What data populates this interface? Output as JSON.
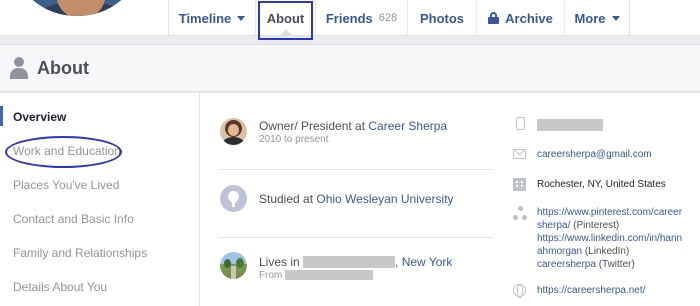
{
  "nav": {
    "tabs": {
      "timeline": "Timeline",
      "about": "About",
      "friends": "Friends",
      "friends_count": "628",
      "photos": "Photos",
      "archive": "Archive",
      "more": "More"
    }
  },
  "section": {
    "title": "About"
  },
  "sidebar": {
    "items": [
      {
        "label": "Overview",
        "active": true
      },
      {
        "label": "Work and Education"
      },
      {
        "label": "Places You've Lived"
      },
      {
        "label": "Contact and Basic Info"
      },
      {
        "label": "Family and Relationships"
      },
      {
        "label": "Details About You"
      }
    ]
  },
  "overview": {
    "work": {
      "prefix": "Owner/ President at ",
      "org": "Career Sherpa",
      "dates": "2010 to present"
    },
    "education": {
      "prefix": "Studied at ",
      "school": "Ohio Wesleyan University"
    },
    "lives": {
      "prefix": "Lives in ",
      "place": ", New York",
      "from": "From"
    }
  },
  "contact": {
    "email": "careersherpa@gmail.com",
    "location": "Rochester, NY, United States",
    "social": {
      "pinterest_url_1": "https://www.pinterest.com/career",
      "pinterest_url_2": "sherpa/",
      "pinterest_note": "(Pinterest)",
      "linkedin_url_1": "https://www.linkedin.com/in/hann",
      "linkedin_url_2": "ahmorgan",
      "linkedin_note": "(LinkedIn)",
      "twitter_handle": "careersherpa",
      "twitter_note": "(Twitter)"
    },
    "website": "https://careersherpa.net/"
  },
  "colors": {
    "link": "#365899",
    "annotation": "#2b34c9",
    "active_bar": "#4267b2"
  }
}
